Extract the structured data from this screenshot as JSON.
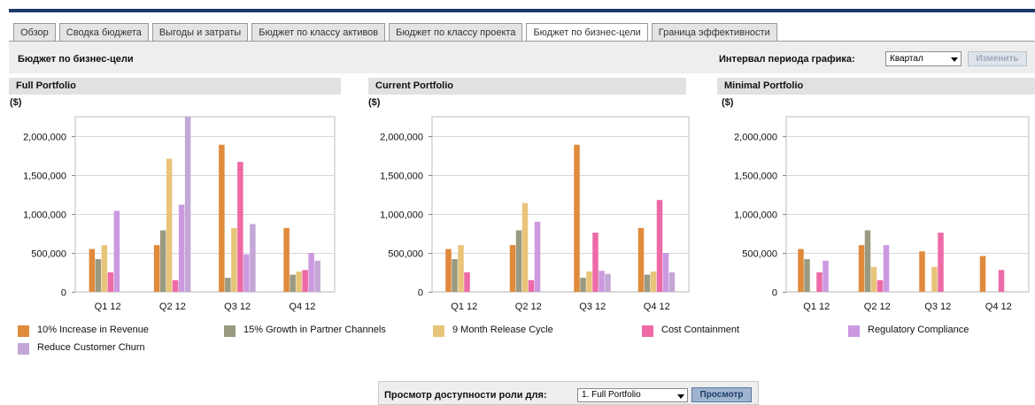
{
  "tabs": [
    {
      "label": "Обзор",
      "active": false
    },
    {
      "label": "Сводка бюджета",
      "active": false
    },
    {
      "label": "Выгоды и затраты",
      "active": false
    },
    {
      "label": "Бюджет по классу активов",
      "active": false
    },
    {
      "label": "Бюджет по классу проекта",
      "active": false
    },
    {
      "label": "Бюджет по бизнес-цели",
      "active": true
    },
    {
      "label": "Граница эффективности",
      "active": false
    }
  ],
  "header": {
    "title": "Бюджет по бизнес-цели",
    "interval_label": "Интервал периода графика:",
    "interval_value": "Квартал",
    "change_button": "Изменить"
  },
  "colors": {
    "10% Increase in Revenue": "#e08a3c",
    "15% Growth in Partner Channels": "#9a9a80",
    "9 Month Release Cycle": "#e8c47a",
    "Cost Containment": "#ee6aa7",
    "Regulatory Compliance": "#cc99e0",
    "Reduce Customer Churn": "#c3a7d6"
  },
  "legend": [
    "10% Increase in Revenue",
    "15% Growth in Partner Channels",
    "9 Month Release Cycle",
    "Cost Containment",
    "Regulatory Compliance",
    "Reduce Customer Churn"
  ],
  "chart_data": [
    {
      "type": "bar",
      "title": "Full Portfolio",
      "ylabel": "($)",
      "ylim": [
        0,
        2250000
      ],
      "yticks": [
        "0",
        "500,000",
        "1,000,000",
        "1,500,000",
        "2,000,000"
      ],
      "categories": [
        "Q1 12",
        "Q2 12",
        "Q3 12",
        "Q4 12"
      ],
      "series": [
        {
          "name": "10% Increase in Revenue",
          "values": [
            550000,
            600000,
            1890000,
            820000
          ]
        },
        {
          "name": "15% Growth in Partner Channels",
          "values": [
            420000,
            790000,
            180000,
            220000
          ]
        },
        {
          "name": "9 Month Release Cycle",
          "values": [
            600000,
            1710000,
            820000,
            260000
          ]
        },
        {
          "name": "Cost Containment",
          "values": [
            250000,
            150000,
            1670000,
            280000
          ]
        },
        {
          "name": "Regulatory Compliance",
          "values": [
            1040000,
            1120000,
            480000,
            500000
          ]
        },
        {
          "name": "Reduce Customer Churn",
          "values": [
            0,
            2250000,
            870000,
            400000
          ]
        }
      ]
    },
    {
      "type": "bar",
      "title": "Current Portfolio",
      "ylabel": "($)",
      "ylim": [
        0,
        2250000
      ],
      "yticks": [
        "0",
        "500,000",
        "1,000,000",
        "1,500,000",
        "2,000,000"
      ],
      "categories": [
        "Q1 12",
        "Q2 12",
        "Q3 12",
        "Q4 12"
      ],
      "series": [
        {
          "name": "10% Increase in Revenue",
          "values": [
            550000,
            600000,
            1890000,
            820000
          ]
        },
        {
          "name": "15% Growth in Partner Channels",
          "values": [
            420000,
            790000,
            180000,
            220000
          ]
        },
        {
          "name": "9 Month Release Cycle",
          "values": [
            600000,
            1140000,
            260000,
            260000
          ]
        },
        {
          "name": "Cost Containment",
          "values": [
            250000,
            150000,
            760000,
            1180000
          ]
        },
        {
          "name": "Regulatory Compliance",
          "values": [
            0,
            900000,
            270000,
            500000
          ]
        },
        {
          "name": "Reduce Customer Churn",
          "values": [
            0,
            0,
            230000,
            250000
          ]
        }
      ]
    },
    {
      "type": "bar",
      "title": "Minimal Portfolio",
      "ylabel": "($)",
      "ylim": [
        0,
        2250000
      ],
      "yticks": [
        "0",
        "500,000",
        "1,000,000",
        "1,500,000",
        "2,000,000"
      ],
      "categories": [
        "Q1 12",
        "Q2 12",
        "Q3 12",
        "Q4 12"
      ],
      "series": [
        {
          "name": "10% Increase in Revenue",
          "values": [
            550000,
            600000,
            520000,
            460000
          ]
        },
        {
          "name": "15% Growth in Partner Channels",
          "values": [
            420000,
            790000,
            0,
            0
          ]
        },
        {
          "name": "9 Month Release Cycle",
          "values": [
            0,
            320000,
            320000,
            0
          ]
        },
        {
          "name": "Cost Containment",
          "values": [
            250000,
            150000,
            760000,
            280000
          ]
        },
        {
          "name": "Regulatory Compliance",
          "values": [
            400000,
            600000,
            0,
            0
          ]
        },
        {
          "name": "Reduce Customer Churn",
          "values": [
            0,
            0,
            0,
            0
          ]
        }
      ]
    }
  ],
  "role_view": {
    "label": "Просмотр доступности роли для:",
    "selected": "1. Full Portfolio",
    "button": "Просмотр"
  }
}
